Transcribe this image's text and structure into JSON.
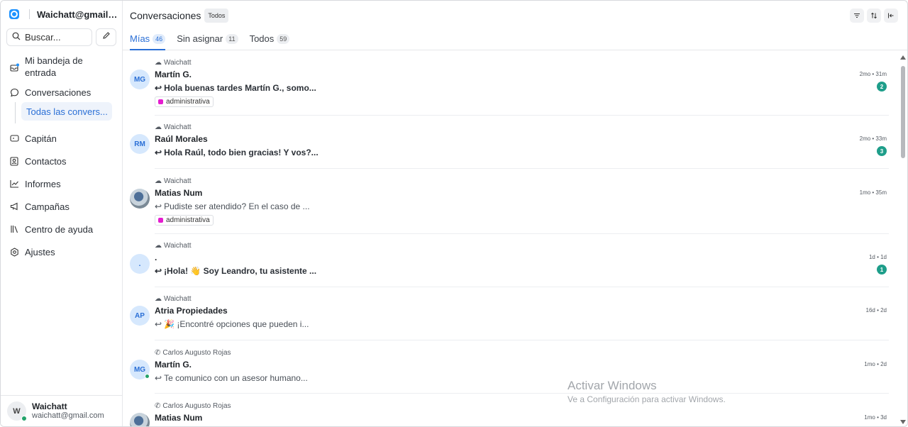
{
  "sidebar": {
    "account_email": "Waichatt@gmail.c...",
    "search_label": "Buscar...",
    "nav": {
      "inbox": "Mi bandeja de entrada",
      "conversations": "Conversaciones",
      "all_conversations": "Todas las convers...",
      "captain": "Capitán",
      "contacts": "Contactos",
      "reports": "Informes",
      "campaigns": "Campañas",
      "help_center": "Centro de ayuda",
      "settings": "Ajustes"
    },
    "user": {
      "initial": "W",
      "name": "Waichatt",
      "email": "waichatt@gmail.com"
    }
  },
  "header": {
    "title": "Conversaciones",
    "filter_badge": "Todos"
  },
  "tabs": [
    {
      "label": "Mías",
      "count": "46"
    },
    {
      "label": "Sin asignar",
      "count": "11"
    },
    {
      "label": "Todos",
      "count": "59"
    }
  ],
  "conversations": [
    {
      "inbox": "Waichatt",
      "name": "Martín G.",
      "initials": "MG",
      "message": "Hola buenas tardes Martín G., somo...",
      "time": "2mo • 31m",
      "unread": "2",
      "tag": "administrativa"
    },
    {
      "inbox": "Waichatt",
      "name": "Raúl Morales",
      "initials": "RM",
      "message": "Hola Raúl, todo bien gracias! Y vos?...",
      "time": "2mo • 33m",
      "unread": "3"
    },
    {
      "inbox": "Waichatt",
      "name": "Matias Num",
      "message": "Pudiste ser atendido? En el caso de ...",
      "time": "1mo • 35m",
      "tag": "administrativa"
    },
    {
      "inbox": "Waichatt",
      "name": ".",
      "initials": ".",
      "message": "¡Hola! 👋 Soy Leandro, tu asistente ...",
      "time": "1d • 1d",
      "unread": "1"
    },
    {
      "inbox": "Waichatt",
      "name": "Atria Propiedades",
      "initials": "AP",
      "message": "🎉 ¡Encontré opciones que pueden i...",
      "time": "16d • 2d"
    },
    {
      "inbox": "Carlos Augusto Rojas",
      "name": "Martín G.",
      "initials": "MG",
      "message": "Te comunico con un asesor humano...",
      "time": "1mo • 2d"
    },
    {
      "inbox": "Carlos Augusto Rojas",
      "name": "Matias Num",
      "message": "",
      "time": "1mo • 3d"
    }
  ],
  "watermark": {
    "line1": "Activar Windows",
    "line2": "Ve a Configuración para activar Windows."
  },
  "colors": {
    "accent": "#2a6fd6",
    "unread_badge": "#1e9e8a",
    "tag_swatch": "#e51ccf"
  }
}
